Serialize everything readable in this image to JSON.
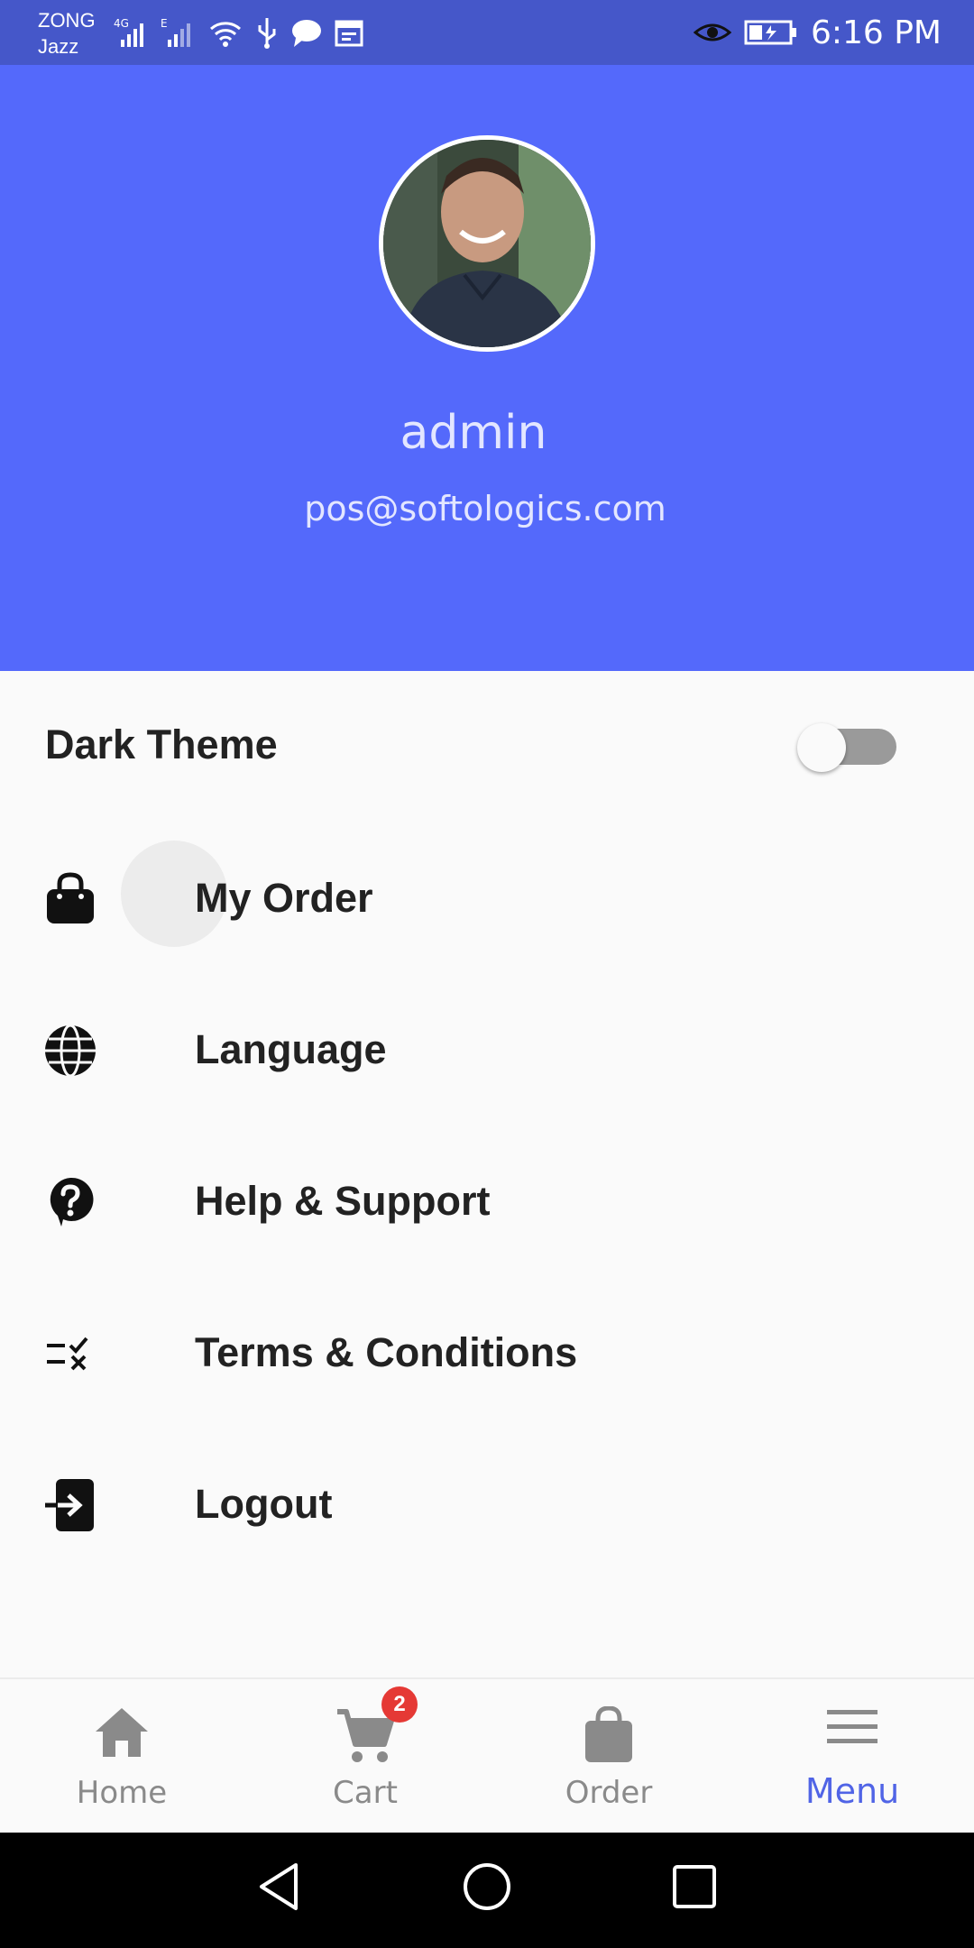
{
  "status_bar": {
    "carrier_1": "ZONG",
    "carrier_2": "Jazz",
    "network_label": "4G",
    "time": "6:16 PM"
  },
  "profile": {
    "name": "admin",
    "email": "pos@softologics.com"
  },
  "settings": {
    "dark_theme_label": "Dark Theme",
    "dark_theme_enabled": false
  },
  "menu": {
    "items": [
      {
        "label": "My Order",
        "icon": "shopping-bag-icon"
      },
      {
        "label": "Language",
        "icon": "globe-icon"
      },
      {
        "label": "Help & Support",
        "icon": "help-icon"
      },
      {
        "label": "Terms & Conditions",
        "icon": "checklist-icon"
      },
      {
        "label": "Logout",
        "icon": "logout-icon"
      }
    ]
  },
  "bottom_nav": {
    "items": [
      {
        "label": "Home",
        "icon": "home-icon"
      },
      {
        "label": "Cart",
        "icon": "cart-icon",
        "badge": "2"
      },
      {
        "label": "Order",
        "icon": "bag-icon"
      },
      {
        "label": "Menu",
        "icon": "menu-icon",
        "active": true
      }
    ]
  },
  "colors": {
    "status_bar": "#4557c9",
    "header": "#5469fb",
    "accent": "#5064e6",
    "badge": "#e53935"
  }
}
